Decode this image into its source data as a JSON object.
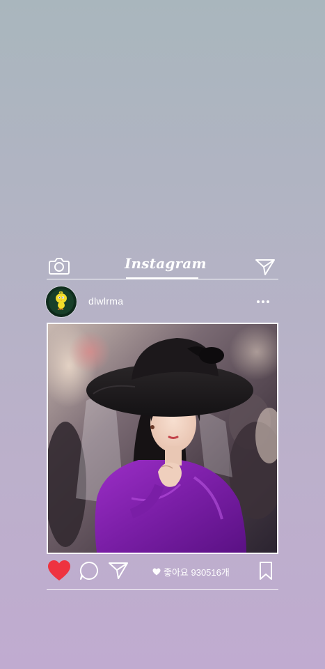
{
  "header": {
    "brand": "Instagram",
    "camera_icon": "camera-icon",
    "direct_icon": "paper-plane-icon"
  },
  "post": {
    "username": "dlwlrma",
    "avatar_icon": "yellow-bird-avatar",
    "more_icon": "more-dots-icon",
    "photo_description_icon": "portrait-photo"
  },
  "actions": {
    "liked": true,
    "like_color": "#ee3340",
    "likes_text": "좋아요 930516개",
    "comment_icon": "comment-bubble-icon",
    "share_icon": "paper-plane-icon",
    "bookmark_icon": "bookmark-icon"
  }
}
